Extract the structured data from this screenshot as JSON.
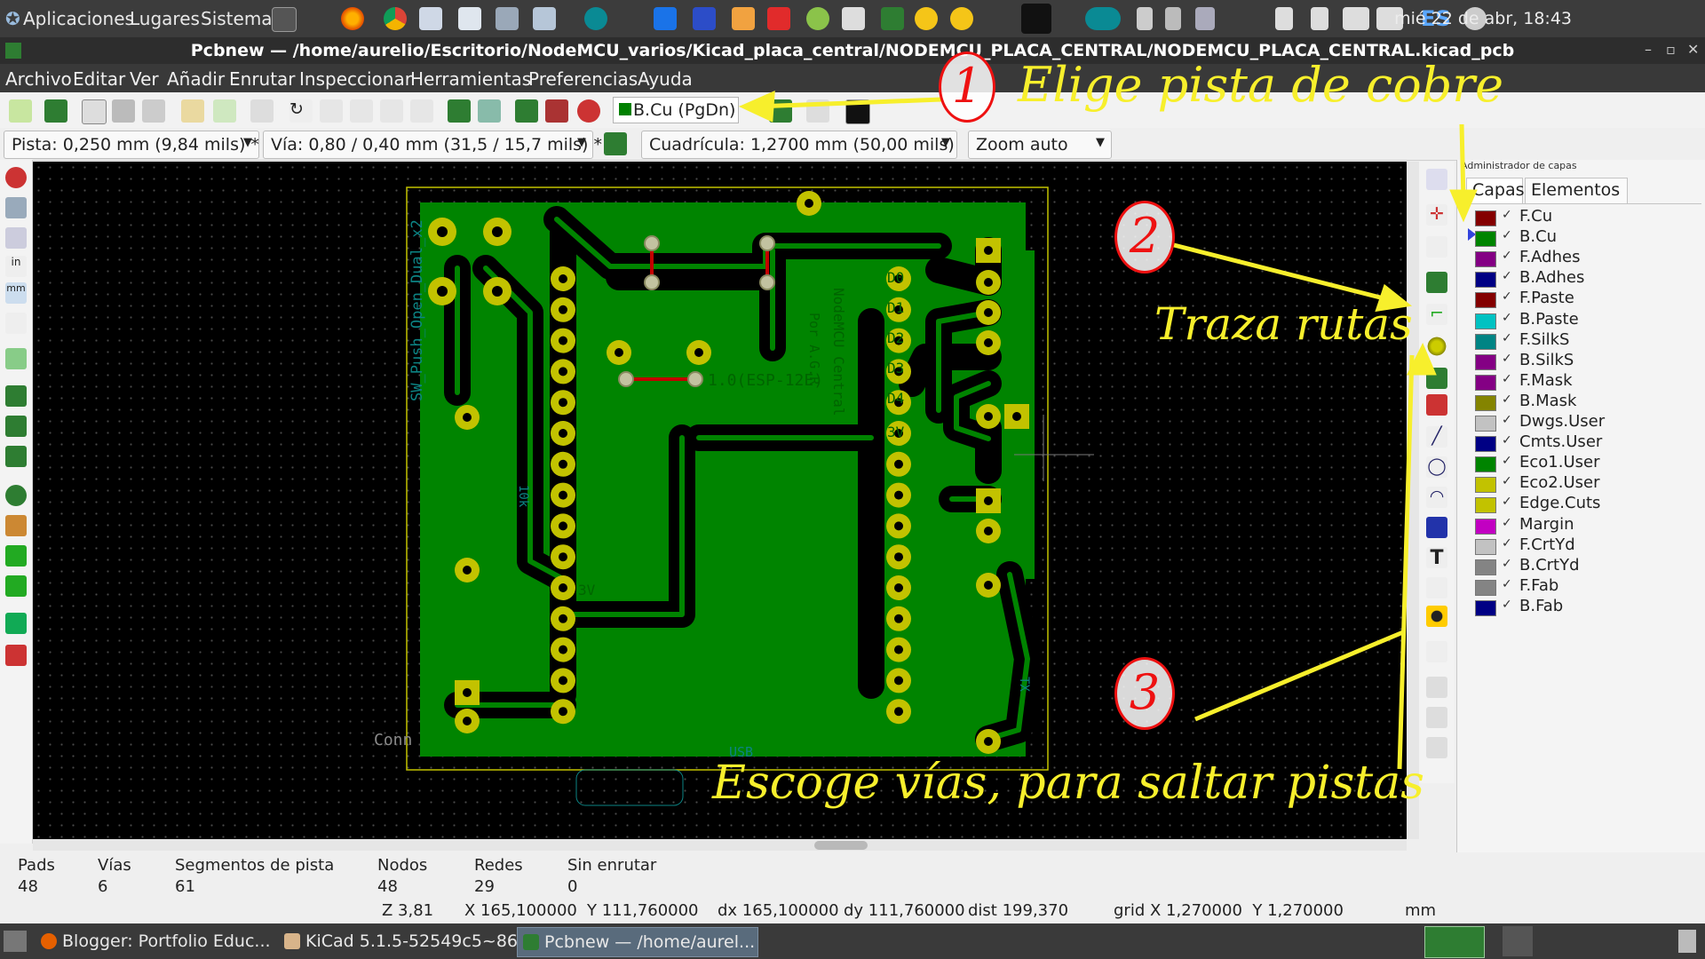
{
  "system_panel": {
    "menus": [
      "Aplicaciones",
      "Lugares",
      "Sistema"
    ],
    "language": "ES",
    "clock": "mié 22 de abr, 18:43"
  },
  "window": {
    "title": "Pcbnew — /home/aurelio/Escritorio/NodeMCU_varios/Kicad_placa_central/NODEMCU_PLACA_CENTRAL/NODEMCU_PLACA_CENTRAL.kicad_pcb"
  },
  "menubar": [
    "Archivo",
    "Editar",
    "Ver",
    "Añadir",
    "Enrutar",
    "Inspeccionar",
    "Herramientas",
    "Preferencias",
    "Ayuda"
  ],
  "toolbar": {
    "active_layer": "B.Cu (PgDn)",
    "track_width": "Pista: 0,250 mm (9,84 mils) *",
    "via_size": "Vía: 0,80 / 0,40 mm (31,5 / 15,7 mils) *",
    "grid": "Cuadrícula: 1,2700 mm (50,00 mils)",
    "zoom": "Zoom auto"
  },
  "layers_panel": {
    "title": "Administrador de capas",
    "tabs": [
      "Capas",
      "Elementos"
    ],
    "active_layer": "B.Cu",
    "layers": [
      {
        "name": "F.Cu",
        "color": "#840000"
      },
      {
        "name": "B.Cu",
        "color": "#008400"
      },
      {
        "name": "F.Adhes",
        "color": "#840084"
      },
      {
        "name": "B.Adhes",
        "color": "#000084"
      },
      {
        "name": "F.Paste",
        "color": "#840000"
      },
      {
        "name": "B.Paste",
        "color": "#00c2c2"
      },
      {
        "name": "F.SilkS",
        "color": "#008484"
      },
      {
        "name": "B.SilkS",
        "color": "#840084"
      },
      {
        "name": "F.Mask",
        "color": "#840084"
      },
      {
        "name": "B.Mask",
        "color": "#848400"
      },
      {
        "name": "Dwgs.User",
        "color": "#c2c2c2"
      },
      {
        "name": "Cmts.User",
        "color": "#000084"
      },
      {
        "name": "Eco1.User",
        "color": "#008400"
      },
      {
        "name": "Eco2.User",
        "color": "#c2c200"
      },
      {
        "name": "Edge.Cuts",
        "color": "#c2c200"
      },
      {
        "name": "Margin",
        "color": "#c200c2"
      },
      {
        "name": "F.CrtYd",
        "color": "#c2c2c2"
      },
      {
        "name": "B.CrtYd",
        "color": "#848484"
      },
      {
        "name": "F.Fab",
        "color": "#848484"
      },
      {
        "name": "B.Fab",
        "color": "#000084"
      }
    ]
  },
  "board": {
    "silk_texts": [
      "SW_Push_Open_Dual_x2",
      "10k",
      "Conn",
      "D0",
      "D1",
      "D2",
      "D3",
      "D4",
      "3V",
      "NodeMCU Central",
      "Por A.G.R",
      "1.0(ESP-12E)",
      "3V",
      "USB",
      "TX"
    ]
  },
  "status": {
    "pads_label": "Pads",
    "pads": "48",
    "vias_label": "Vías",
    "vias": "6",
    "segments_label": "Segmentos de pista",
    "segments": "61",
    "nodes_label": "Nodos",
    "nodes": "48",
    "nets_label": "Redes",
    "nets": "29",
    "unrouted_label": "Sin enrutar",
    "unrouted": "0",
    "z": "Z 3,81",
    "x": "X 165,100000",
    "y": "Y 111,760000",
    "dx": "dx 165,100000",
    "dy": "dy 111,760000",
    "dist": "dist 199,370",
    "grid": "grid X 1,270000  Y 1,270000",
    "units": "mm"
  },
  "annotations": {
    "step1_num": "1",
    "step1_text": "Elige pista de cobre",
    "step2_num": "2",
    "step2_text": "Traza rutas",
    "step3_num": "3",
    "step3_text": "Escoge vías, para saltar pistas"
  },
  "taskbar": [
    "Blogger: Portfolio Educ...",
    "KiCad 5.1.5-52549c5~86...",
    "Pcbnew — /home/aurel..."
  ]
}
